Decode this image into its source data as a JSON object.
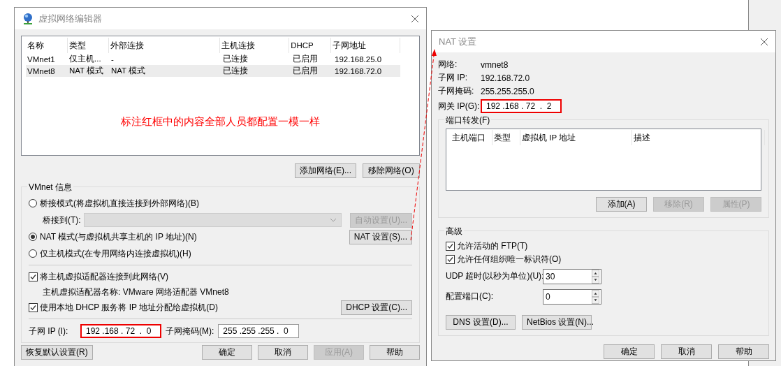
{
  "main_window": {
    "title": "虚拟网络编辑器",
    "table": {
      "columns": [
        "名称",
        "类型",
        "外部连接",
        "主机连接",
        "DHCP",
        "子网地址"
      ],
      "rows": [
        {
          "cells": [
            "VMnet1",
            "仅主机...",
            "-",
            "已连接",
            "已启用",
            "192.168.25.0"
          ],
          "selected": false
        },
        {
          "cells": [
            "VMnet8",
            "NAT 模式",
            "NAT 模式",
            "已连接",
            "已启用",
            "192.168.72.0"
          ],
          "selected": true
        }
      ]
    },
    "annotation": "标注红框中的内容全部人员都配置一模一样",
    "list_buttons": [
      {
        "label": "添加网络(E)...",
        "disabled": false
      },
      {
        "label": "移除网络(O)",
        "disabled": false
      }
    ],
    "vmnet_info": {
      "title": "VMnet 信息",
      "bridged": {
        "label": "桥接模式(将虚拟机直接连接到外部网络)(B)",
        "selected": false
      },
      "bridge_to": {
        "label": "桥接到(T):",
        "disabled": true
      },
      "auto_button": {
        "label": "自动设置(U)...",
        "disabled": true
      },
      "nat": {
        "label": "NAT 模式(与虚拟机共享主机的 IP 地址)(N)",
        "selected": true
      },
      "nat_button": {
        "label": "NAT 设置(S)...",
        "disabled": false
      },
      "host_only": {
        "label": "仅主机模式(在专用网络内连接虚拟机)(H)",
        "selected": false
      },
      "connect_adapter": {
        "label": "将主机虚拟适配器连接到此网络(V)",
        "checked": true
      },
      "adapter_name": "主机虚拟适配器名称: VMware 网络适配器 VMnet8",
      "use_dhcp": {
        "label": "使用本地 DHCP 服务将 IP 地址分配给虚拟机(D)",
        "checked": true
      },
      "dhcp_button": {
        "label": "DHCP 设置(C)...",
        "disabled": false
      },
      "subnet_ip": {
        "label": "子网 IP (I):",
        "value": "192 .168 . 72  .  0",
        "highlighted": true
      },
      "subnet_mask": {
        "label": "子网掩码(M):",
        "value": "255 .255 .255 .  0",
        "highlighted": false
      }
    },
    "footer_buttons": [
      {
        "label": "恢复默认设置(R)",
        "disabled": false
      },
      {
        "label": "确定",
        "disabled": false
      },
      {
        "label": "取消",
        "disabled": false
      },
      {
        "label": "应用(A)",
        "disabled": true
      },
      {
        "label": "帮助",
        "disabled": false
      }
    ]
  },
  "nat_window": {
    "title": "NAT 设置",
    "info": [
      {
        "label": "网络:",
        "value": "vmnet8"
      },
      {
        "label": "子网 IP:",
        "value": "192.168.72.0"
      },
      {
        "label": "子网掩码:",
        "value": "255.255.255.0"
      }
    ],
    "gateway": {
      "label": "网关 IP(G):",
      "value": "192 .168 . 72  .  2",
      "highlighted": true
    },
    "port_forwarding": {
      "title": "端口转发(F)",
      "columns": [
        "主机端口",
        "类型",
        "虚拟机 IP 地址",
        "描述"
      ],
      "buttons": [
        {
          "label": "添加(A)",
          "disabled": false
        },
        {
          "label": "移除(R)",
          "disabled": true
        },
        {
          "label": "属性(P)",
          "disabled": true
        }
      ]
    },
    "advanced": {
      "title": "高级",
      "checkboxes": [
        {
          "label": "允许活动的 FTP(T)",
          "checked": true
        },
        {
          "label": "允许任何组织唯一标识符(O)",
          "checked": true
        }
      ],
      "spinners": [
        {
          "label": "UDP 超时(以秒为单位)(U):",
          "value": "30"
        },
        {
          "label": "配置端口(C):",
          "value": "0"
        }
      ],
      "buttons": [
        {
          "label": "DNS 设置(D)...",
          "disabled": false
        },
        {
          "label": "NetBios 设置(N)...",
          "disabled": false
        }
      ]
    },
    "footer_buttons": [
      {
        "label": "确定",
        "disabled": false
      },
      {
        "label": "取消",
        "disabled": false
      },
      {
        "label": "帮助",
        "disabled": false
      }
    ]
  }
}
